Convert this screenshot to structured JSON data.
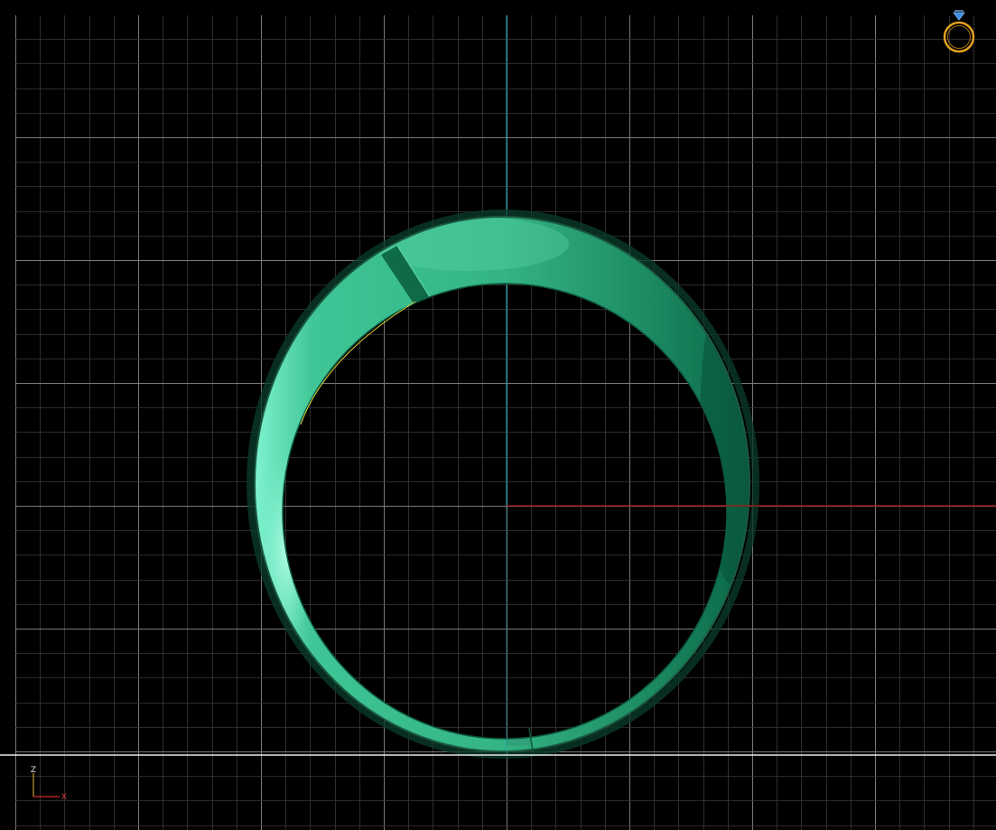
{
  "viewport": {
    "view": "front",
    "grid": true,
    "background_color": "#000000",
    "grid_minor_color": "#3a3a3a",
    "grid_major_color": "#7a7a7a",
    "vertical_axis_color": "#1aa3b8",
    "horizontal_axis_color": "#b01818",
    "ground_line_color": "#e8e8e8"
  },
  "model": {
    "object": "ring-band",
    "material_color": "#2aa878",
    "highlight_color": "#8ef5d4",
    "edge_color": "#e6d63a"
  },
  "axis_gizmo": {
    "vertical_label": "Z",
    "horizontal_label": "X",
    "vertical_color": "#c49a2a",
    "horizontal_color": "#d02a2a"
  },
  "view_cube": {
    "icon": "ring-diamond-icon",
    "ring_color": "#e0a020",
    "gem_color": "#3a8ee8"
  }
}
